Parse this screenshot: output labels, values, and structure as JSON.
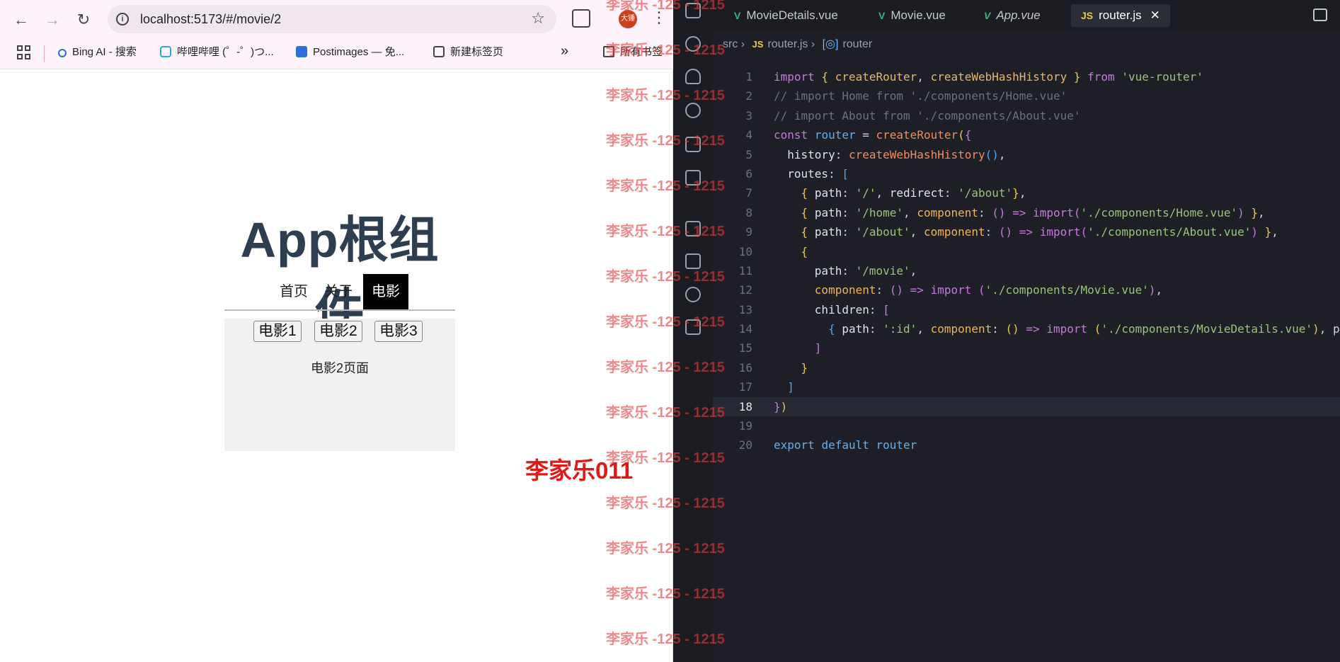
{
  "browser": {
    "url": "localhost:5173/#/movie/2",
    "avatar_text": "大锤",
    "bookmarks": [
      {
        "label": "Bing AI - 搜索"
      },
      {
        "label": "哔哩哔哩 (゜-゜)つ..."
      },
      {
        "label": "Postimages — 免..."
      },
      {
        "label": "新建标签页"
      }
    ],
    "more_bookmarks": "»",
    "all_bookmarks": "所有书签"
  },
  "app": {
    "title": "App根组件",
    "nav": [
      {
        "label": "首页",
        "active": false
      },
      {
        "label": "关于",
        "active": false
      },
      {
        "label": "电影",
        "active": true
      }
    ],
    "movies": [
      "电影1",
      "电影2",
      "电影3"
    ],
    "movie_page": "电影2页面"
  },
  "watermark": {
    "text": "李家乐 -125 - 1215",
    "big_text": "李家乐011"
  },
  "editor": {
    "tabs": [
      {
        "label": "MovieDetails.vue",
        "kind": "vue"
      },
      {
        "label": "Movie.vue",
        "kind": "vue"
      },
      {
        "label": "App.vue",
        "kind": "vue"
      },
      {
        "label": "router.js",
        "kind": "js",
        "active": true
      }
    ],
    "breadcrumb": {
      "src": "src",
      "file": "router.js",
      "symbol": "router"
    },
    "line_numbers": [
      "1",
      "2",
      "3",
      "4",
      "5",
      "6",
      "7",
      "8",
      "9",
      "10",
      "11",
      "12",
      "13",
      "14",
      "15",
      "16",
      "17",
      "18",
      "19",
      "20"
    ]
  },
  "colors": {
    "accent_active_nav": "#000000",
    "watermark": "#e23c3c",
    "editor_bg": "#1e1f26"
  }
}
